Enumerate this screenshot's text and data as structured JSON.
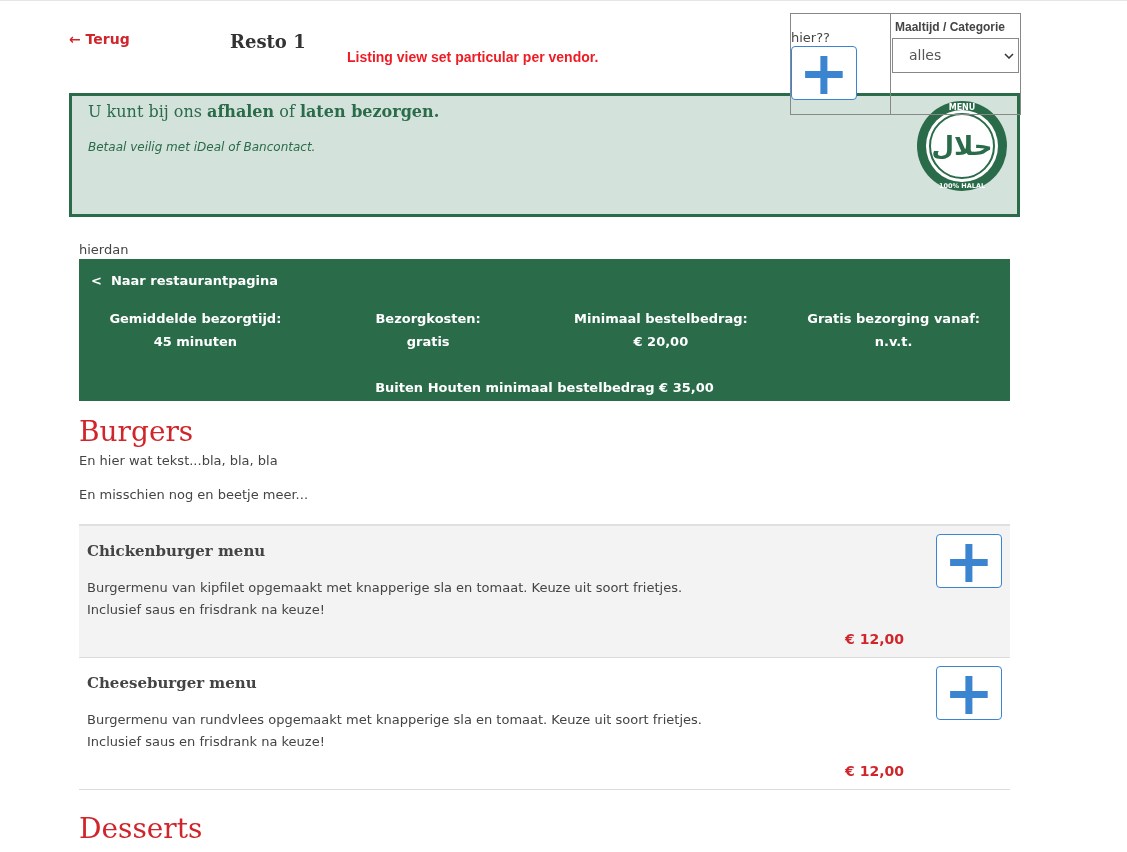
{
  "header": {
    "back_link": "← Terug",
    "title": "Resto 1",
    "note": "Listing view set particular per vendor."
  },
  "overlay": {
    "label": "hier??",
    "add_button": "+",
    "filter_label": "Maaltijd / Categorie",
    "filter_value": "alles"
  },
  "banner": {
    "headline": "U kunt bij ons **afhalen** of **laten bezorgen.**",
    "subline": "Betaal veilig met iDeal of Bancontact.",
    "logo": {
      "top": "MENU",
      "center": "حلال",
      "bottom": "100% HALAL"
    }
  },
  "debug_label": "hierdan",
  "info": {
    "back_link": "<  Naar restaurantpagina",
    "stats": [
      {
        "label": "Gemiddelde bezorgtijd:",
        "value": "45 minuten"
      },
      {
        "label": "Bezorgkosten:",
        "value": "gratis"
      },
      {
        "label": "Minimaal bestelbedrag:",
        "value": "€ 20,00"
      },
      {
        "label": "Gratis bezorging vanaf:",
        "value": "n.v.t."
      }
    ],
    "footer": "Buiten Houten minimaal bestelbedrag € 35,00"
  },
  "categories": [
    {
      "title": "Burgers",
      "intro": [
        "En hier wat tekst...bla, bla, bla",
        "En misschien nog en beetje meer..."
      ],
      "items": [
        {
          "name": "Chickenburger menu",
          "description": [
            "Burgermenu van kipfilet opgemaakt met knapperige sla en tomaat. Keuze uit soort frietjes.",
            "Inclusief saus en frisdrank na keuze!"
          ],
          "price": "€ 12,00",
          "selected": true,
          "add": "+"
        },
        {
          "name": "Cheeseburger menu",
          "description": [
            "Burgermenu van rundvlees opgemaakt met knapperige sla en tomaat. Keuze uit soort frietjes.",
            "Inclusief saus en frisdrank na keuze!"
          ],
          "price": "€ 12,00",
          "selected": false,
          "add": "+"
        }
      ]
    },
    {
      "title": "Desserts"
    }
  ]
}
